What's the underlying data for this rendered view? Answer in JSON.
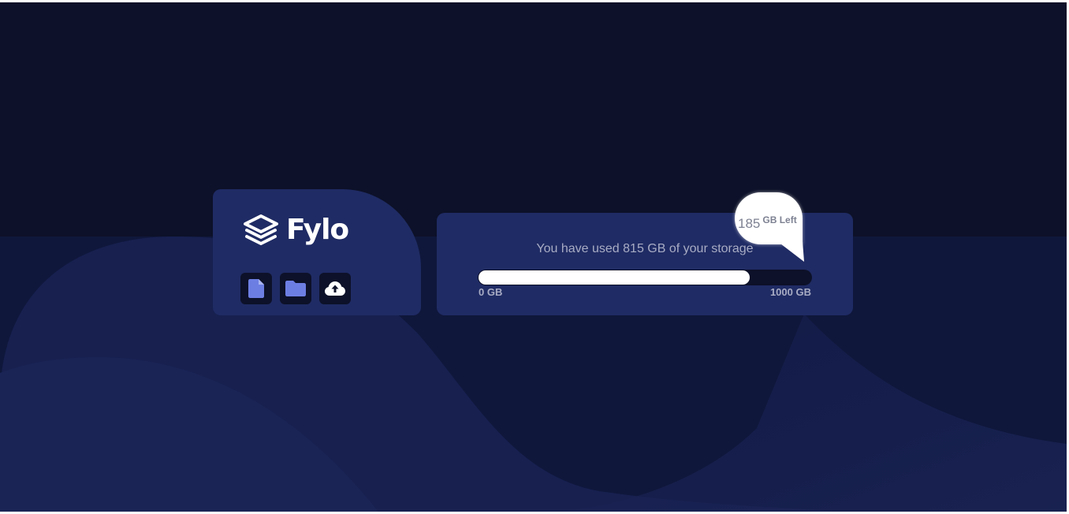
{
  "brand": {
    "name": "Fylo",
    "logo_icon": "layers-icon"
  },
  "toolbar": {
    "buttons": [
      {
        "icon": "document-icon"
      },
      {
        "icon": "folder-icon"
      },
      {
        "icon": "cloud-upload-icon"
      }
    ]
  },
  "storage": {
    "usage_text": "You have used 815 GB of your storage",
    "used_gb": 815,
    "total_gb": 1000,
    "used_fraction": 0.815,
    "scale_min_label": "0 GB",
    "scale_max_label": "1000 GB",
    "remaining_value": "185",
    "remaining_unit": "GB Left"
  },
  "colors": {
    "background": "#0d1129",
    "card": "#1f2b64",
    "icon_accent": "#6d7ee3",
    "text_muted": "#a8acc4",
    "bar_fill": "#ffffff"
  }
}
